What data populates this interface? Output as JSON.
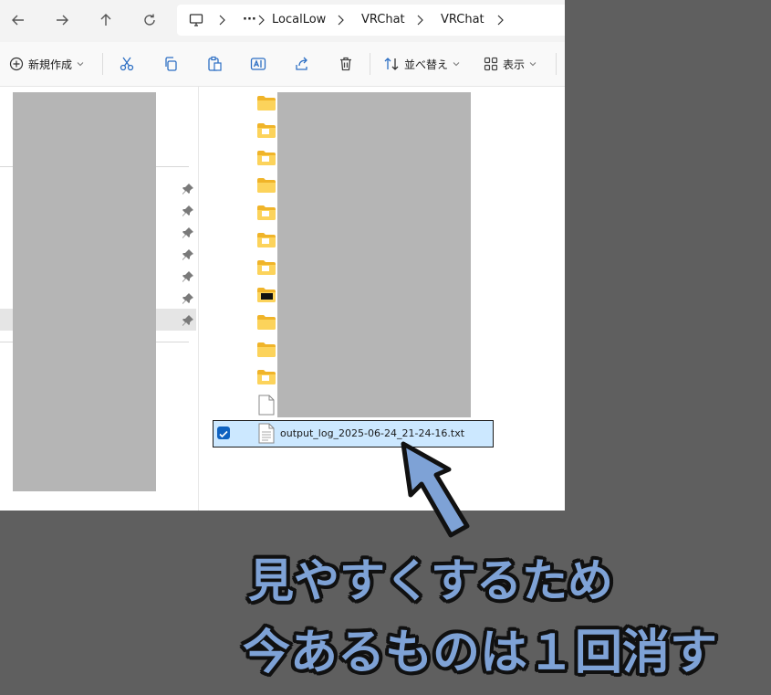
{
  "breadcrumb": {
    "more": "···",
    "items": [
      "LocalLow",
      "VRChat",
      "VRChat"
    ]
  },
  "toolbar": {
    "new_label": "新規作成",
    "sort_label": "並べ替え",
    "view_label": "表示"
  },
  "file_list": {
    "folder_icon_count": 11,
    "selected_file": "output_log_2025-06-24_21-24-16.txt"
  },
  "caption": {
    "line1": "見やすくするため",
    "line2": "今あるものは１回消す"
  },
  "colors": {
    "caption_fill": "#7ea2d6",
    "selection_bg": "#cce8ff",
    "checkbox": "#0f62c0",
    "backdrop": "#5f5f5f"
  },
  "icons": [
    "back-arrow",
    "forward-arrow",
    "up-arrow",
    "refresh",
    "monitor",
    "scissors",
    "copy",
    "paste",
    "rename",
    "share",
    "trash",
    "sort-arrows",
    "grid-view",
    "pin",
    "folder",
    "text-file"
  ]
}
